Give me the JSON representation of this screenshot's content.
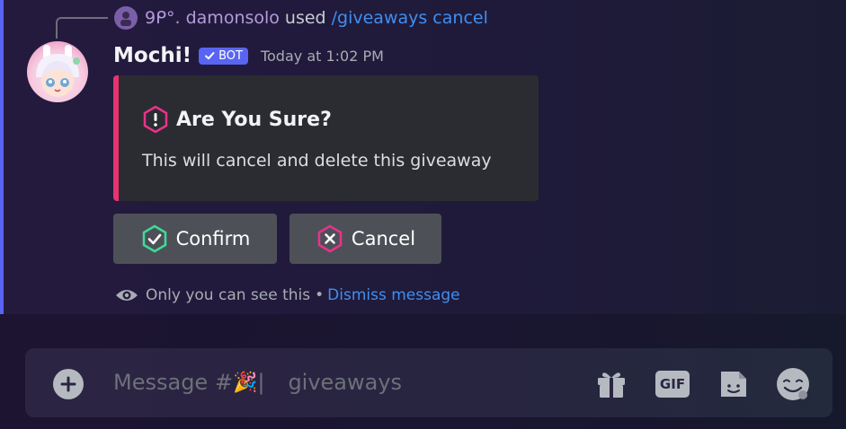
{
  "reply": {
    "username": "9ᑭ°. damonsolo",
    "used_text": "used",
    "command": "/giveaways cancel"
  },
  "message": {
    "bot_name": "Mochi!",
    "bot_badge": "BOT",
    "timestamp": "Today at 1:02 PM"
  },
  "embed": {
    "title": "Are You Sure?",
    "description": "This will cancel and delete this giveaway",
    "accent_color": "#e8336f"
  },
  "buttons": {
    "confirm_label": "Confirm",
    "cancel_label": "Cancel"
  },
  "ephemeral": {
    "notice": "Only you can see this",
    "separator": "•",
    "dismiss_label": "Dismiss message"
  },
  "composer": {
    "placeholder_prefix": "Message #",
    "channel_emoji": "🎉",
    "placeholder_channel": "giveaways"
  },
  "icons": {
    "gift": "gift-icon",
    "gif": "gif-icon",
    "gif_text": "GIF",
    "sticker": "sticker-icon",
    "emoji": "emoji-icon",
    "plus": "plus-icon"
  },
  "colors": {
    "accent_bar": "#5865f2",
    "link": "#3f8ff0",
    "button_bg": "#4e5058"
  }
}
